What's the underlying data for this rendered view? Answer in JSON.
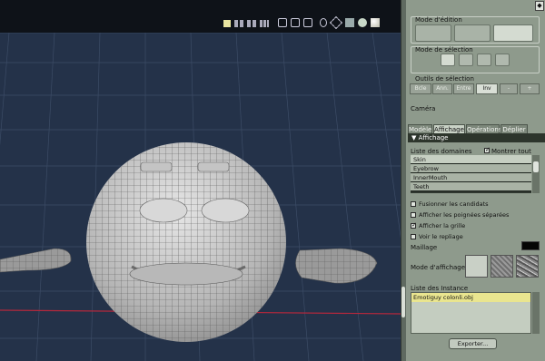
{
  "viewport": {
    "toolbar_icons": [
      "single-view-icon",
      "dual-view-icon",
      "quad-view-icon",
      "grid-view-icon",
      "camera-icon",
      "camera-icon",
      "camera-icon",
      "light-icon",
      "cube-wire-icon",
      "cube-solid-icon",
      "sphere-icon",
      "sphere-lit-icon"
    ]
  },
  "panel": {
    "mode_edition_label": "Mode d'édition",
    "mode_selection_label": "Mode de sélection",
    "outils_label": "Outils de sélection",
    "tools": [
      "Bcle",
      "Ann.",
      "Entre",
      "Inv",
      "-",
      "+"
    ],
    "camera_label": "Caméra",
    "tabs": [
      "Modèle",
      "Affichage",
      "Opérations",
      "Déplier"
    ],
    "active_tab": "Affichage",
    "affichage_header": "Affichage",
    "domains_label": "Liste des domaines",
    "show_all_label": "Montrer tout",
    "domains": [
      "Skin",
      "Eyebrow",
      "InnerMouth",
      "Teeth"
    ],
    "options": [
      {
        "label": "Fusionner les candidats",
        "checked": false
      },
      {
        "label": "Afficher les poignées séparées",
        "checked": false
      },
      {
        "label": "Afficher la grille",
        "checked": true
      },
      {
        "label": "Voir le repliage",
        "checked": false
      }
    ],
    "maillage_label": "Maillage",
    "maillage_color": "#050505",
    "mode_affichage_label": "Mode d'affichage",
    "instances_label": "Liste des Instance",
    "instances": [
      "Emotiguy colonli.obj"
    ],
    "export_label": "Exporter...",
    "top_button": "◆"
  }
}
